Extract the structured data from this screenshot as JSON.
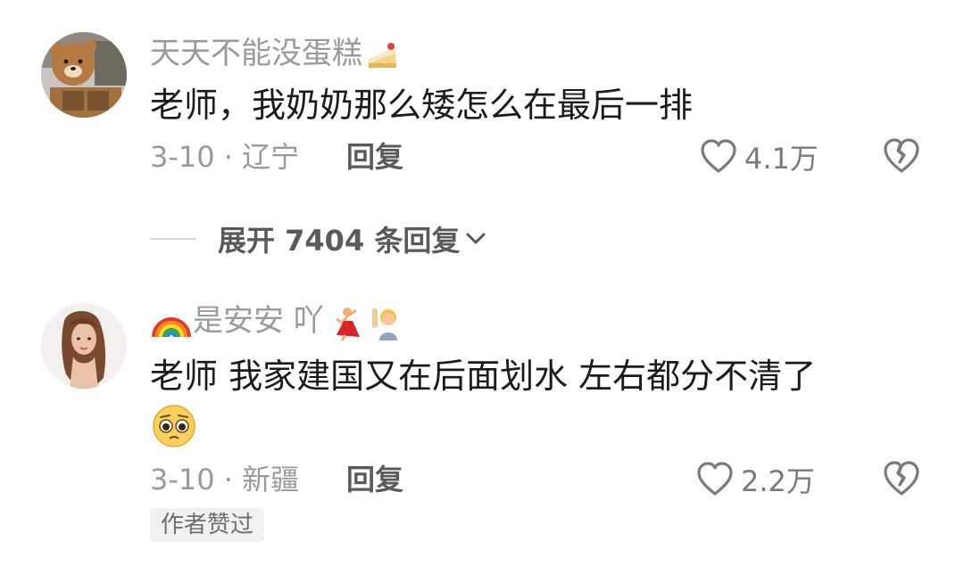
{
  "comments": [
    {
      "username": "天天不能没蛋糕",
      "username_icon": "cake-emoji-icon",
      "content": "老师，我奶奶那么矮怎么在最后一排",
      "date_location": "3-10 · 辽宁",
      "reply_label": "回复",
      "likes": "4.1万",
      "avatar_icon": "bear-avatar-icon"
    },
    {
      "username_prefix_icon": "rainbow-emoji-icon",
      "username": "是安安 吖",
      "username_suffix_icons": [
        "dancer-emoji-icon",
        "raising-hand-emoji-icon"
      ],
      "content": "老师 我家建国又在后面划水 左右都分不清了",
      "content_emoji": "pleading-face-emoji-icon",
      "date_location": "3-10 · 新疆",
      "reply_label": "回复",
      "likes": "2.2万",
      "author_badge": "作者赞过",
      "avatar_icon": "girl-portrait-avatar-icon"
    }
  ],
  "expand_replies": {
    "label": "展开 7404 条回复",
    "icon": "chevron-down-icon"
  },
  "colors": {
    "text_primary": "#1b1b1b",
    "text_secondary": "#9a9a9a",
    "action_text": "#5a5a5a",
    "badge_bg": "#f1f1f1"
  }
}
